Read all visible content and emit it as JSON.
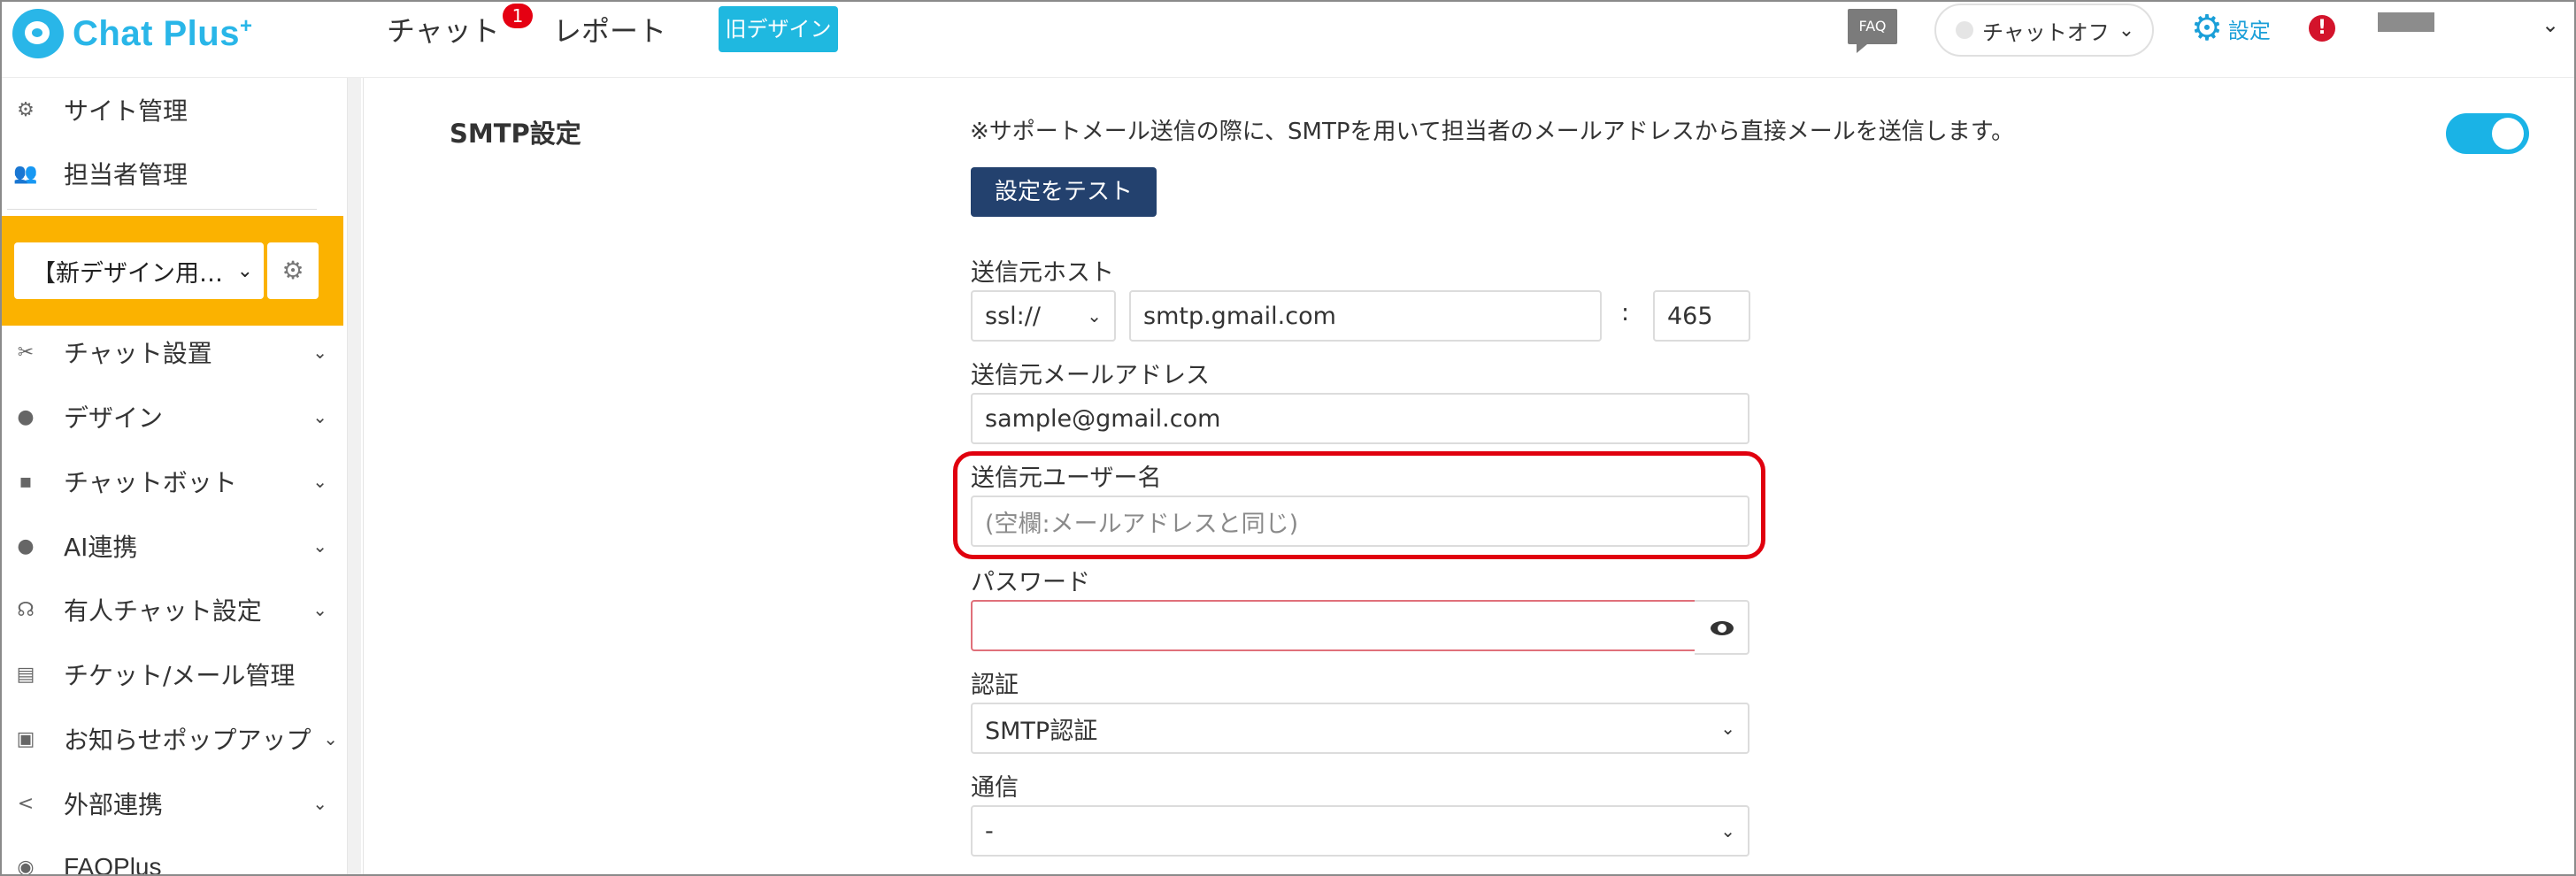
{
  "header": {
    "logo_text": "Chat Plus",
    "logo_sup": "+",
    "nav_chat": "チャット",
    "nav_chat_badge": "1",
    "nav_report": "レポート",
    "old_design": "旧デザイン",
    "faq": "FAQ",
    "status": "チャットオフ",
    "settings": "設定",
    "alert": "!"
  },
  "sidebar": {
    "items": [
      {
        "label": "サイト管理",
        "icon": "gear-icon"
      },
      {
        "label": "担当者管理",
        "icon": "users-icon"
      },
      {
        "label": "チャット設置",
        "icon": "tools-icon"
      },
      {
        "label": "デザイン",
        "icon": "palette-icon"
      },
      {
        "label": "チャットボット",
        "icon": "chat-icon"
      },
      {
        "label": "AI連携",
        "icon": "ai-icon"
      },
      {
        "label": "有人チャット設定",
        "icon": "headset-icon"
      },
      {
        "label": "チケット/メール管理",
        "icon": "ticket-icon"
      },
      {
        "label": "お知らせポップアップ",
        "icon": "popup-icon"
      },
      {
        "label": "外部連携",
        "icon": "share-icon"
      },
      {
        "label": "FAQPlus",
        "icon": "faq-plus-icon"
      }
    ],
    "site_select": "【新デザイン用…"
  },
  "main": {
    "section_title": "SMTP設定",
    "note": "※サポートメール送信の際に、SMTPを用いて担当者のメールアドレスから直接メールを送信します。",
    "test_button": "設定をテスト",
    "host_label": "送信元ホスト",
    "protocol": "ssl://",
    "host": "smtp.gmail.com",
    "colon": ":",
    "port": "465",
    "email_label": "送信元メールアドレス",
    "email": "sample@gmail.com",
    "username_label": "送信元ユーザー名",
    "username_placeholder": "(空欄:メールアドレスと同じ)",
    "password_label": "パスワード",
    "password": "",
    "auth_label": "認証",
    "auth": "SMTP認証",
    "comm_label": "通信",
    "comm": "-"
  },
  "colors": {
    "accent": "#1ab3e6",
    "sidebar_highlight": "#fbb200",
    "test_button": "#23416e",
    "highlight_border": "#e0000e"
  }
}
